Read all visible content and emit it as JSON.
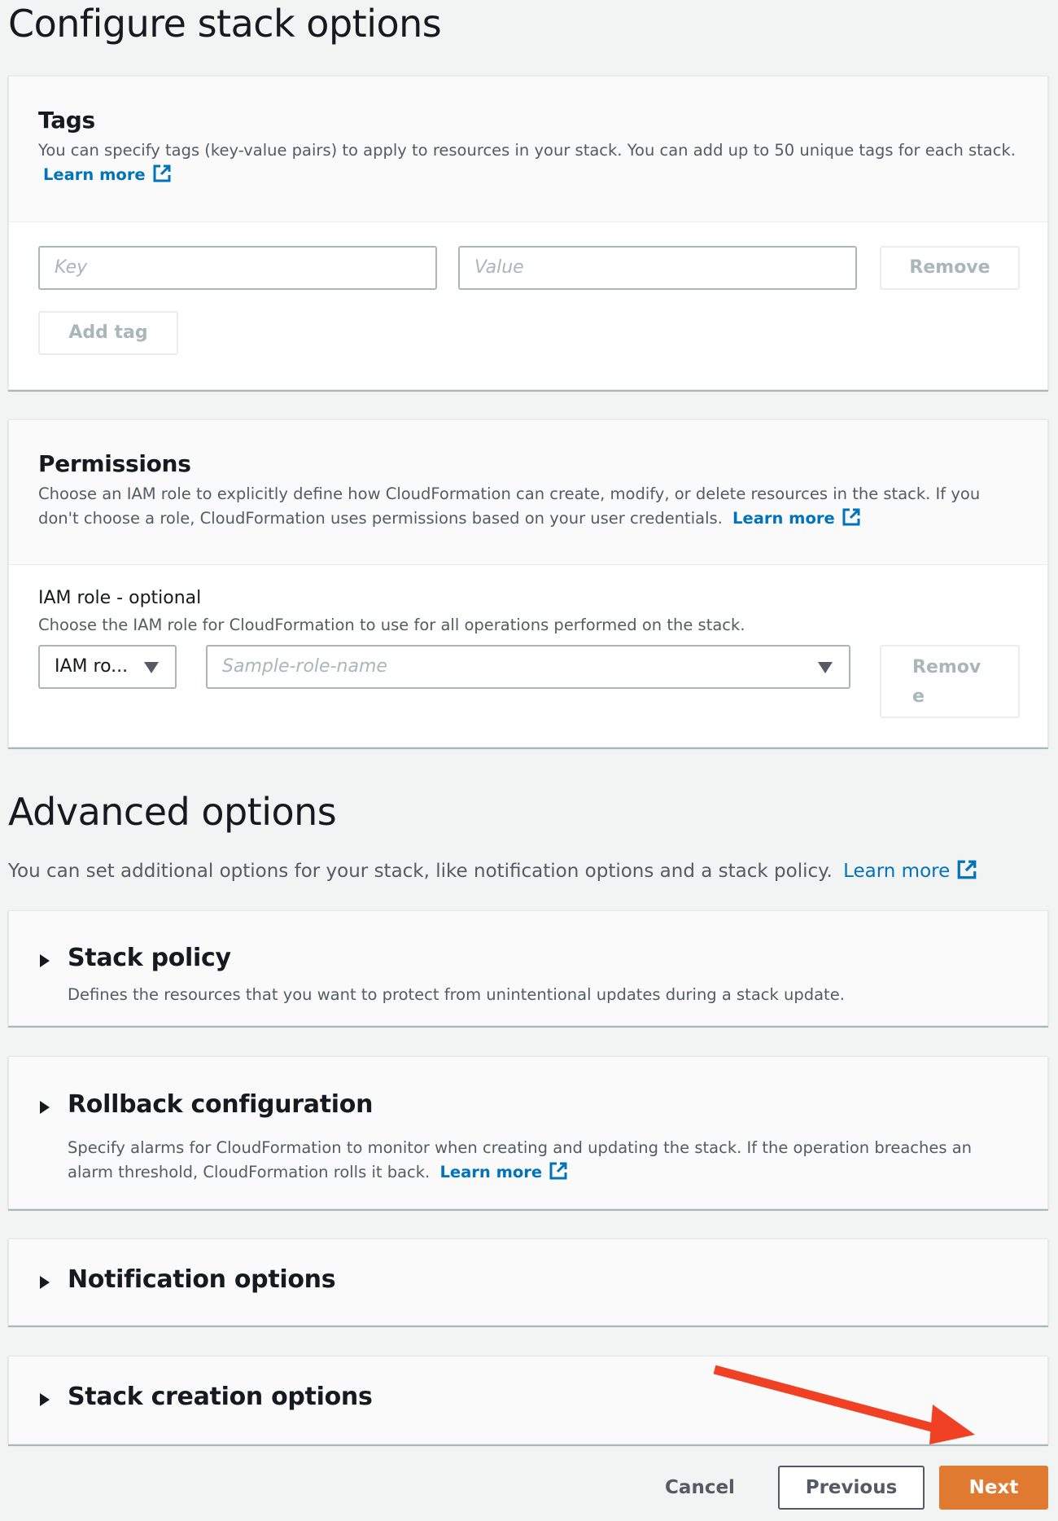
{
  "page": {
    "title": "Configure stack options"
  },
  "tags": {
    "title": "Tags",
    "description": "You can specify tags (key-value pairs) to apply to resources in your stack. You can add up to 50 unique tags for each stack.",
    "learn_more": "Learn more",
    "key_placeholder": "Key",
    "value_placeholder": "Value",
    "remove_label": "Remove",
    "add_tag_label": "Add tag"
  },
  "permissions": {
    "title": "Permissions",
    "description": "Choose an IAM role to explicitly define how CloudFormation can create, modify, or delete resources in the stack. If you don't choose a role, CloudFormation uses permissions based on your user credentials.",
    "learn_more": "Learn more",
    "iam_role_label": "IAM role - optional",
    "iam_role_description": "Choose the IAM role for CloudFormation to use for all operations performed on the stack.",
    "role_type_selected": "IAM ro...",
    "role_name_placeholder": "Sample-role-name",
    "remove_line1": "Remov",
    "remove_line2": "e"
  },
  "advanced": {
    "title": "Advanced options",
    "description": "You can set additional options for your stack, like notification options and a stack policy.",
    "learn_more": "Learn more",
    "sections": [
      {
        "title": "Stack policy",
        "description": "Defines the resources that you want to protect from unintentional updates during a stack update."
      },
      {
        "title": "Rollback configuration",
        "description": "Specify alarms for CloudFormation to monitor when creating and updating the stack. If the operation breaches an alarm threshold, CloudFormation rolls it back.",
        "learn_more": "Learn more"
      },
      {
        "title": "Notification options"
      },
      {
        "title": "Stack creation options"
      }
    ]
  },
  "footer": {
    "cancel_label": "Cancel",
    "previous_label": "Previous",
    "next_label": "Next"
  },
  "colors": {
    "link": "#0073bb",
    "primary_button": "#e07a31",
    "annotation_arrow": "#f04124",
    "background": "#f2f3f3"
  }
}
